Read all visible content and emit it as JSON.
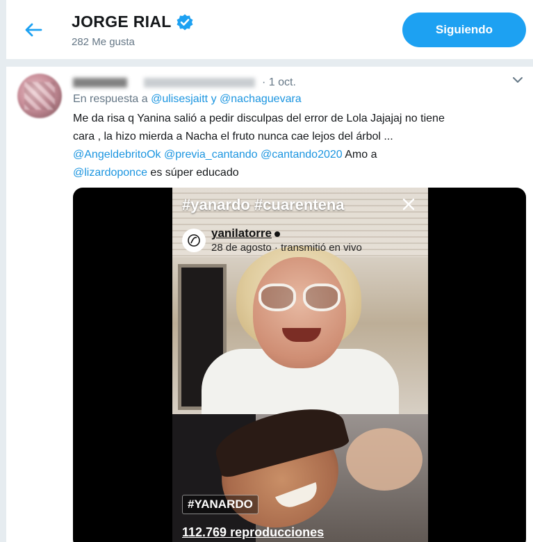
{
  "header": {
    "title": "JORGE RIAL",
    "likes": "282 Me gusta",
    "follow_label": "Siguiendo"
  },
  "tweet": {
    "date": "· 1 oct.",
    "reply_prefix": "En respuesta a",
    "reply_user1": "@ulisesjaitt",
    "reply_and": "y",
    "reply_user2": "@nachaguevara",
    "text_line1": "Me da risa q Yanina salió a pedir disculpas del  error  de Lola Jajajaj no tiene",
    "text_line2": "cara , la hizo mierda a Nacha el fruto nunca cae lejos del árbol ...",
    "mention1": "@AngeldebritoOk",
    "mention2": "@previa_cantando",
    "mention3": "@cantando2020",
    "text_amo": "Amo a",
    "mention4": "@lizardoponce",
    "text_end": "es súper educado"
  },
  "media": {
    "hashtags": "#yanardo #cuarentena",
    "username": "yanilatorre",
    "subline": "28 de agosto · transmitió en vivo",
    "tag": "#YANARDO",
    "views": "112.769 reproducciones"
  },
  "colors": {
    "accent": "#1da1f2",
    "link": "#1b95e0",
    "muted": "#657786"
  },
  "icons": {
    "back": "arrow-left-icon",
    "verified": "verified-badge-icon",
    "caret": "chevron-down-icon",
    "close": "close-icon"
  }
}
